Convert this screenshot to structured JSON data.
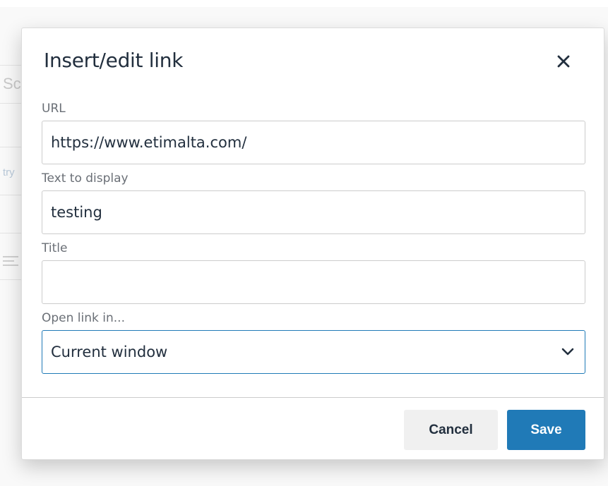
{
  "background": {
    "fragment_1": "Sc",
    "fragment_2": "try"
  },
  "dialog": {
    "title": "Insert/edit link",
    "close_icon": "close-icon"
  },
  "form": {
    "url": {
      "label": "URL",
      "value": "https://www.etimalta.com/"
    },
    "text_to_display": {
      "label": "Text to display",
      "value": "testing"
    },
    "title": {
      "label": "Title",
      "value": ""
    },
    "target": {
      "label": "Open link in...",
      "selected": "Current window",
      "icon": "chevron-down-icon"
    }
  },
  "footer": {
    "cancel_label": "Cancel",
    "save_label": "Save"
  },
  "colors": {
    "primary": "#207ab7",
    "text": "#222f3e",
    "label": "#6a6f76"
  }
}
